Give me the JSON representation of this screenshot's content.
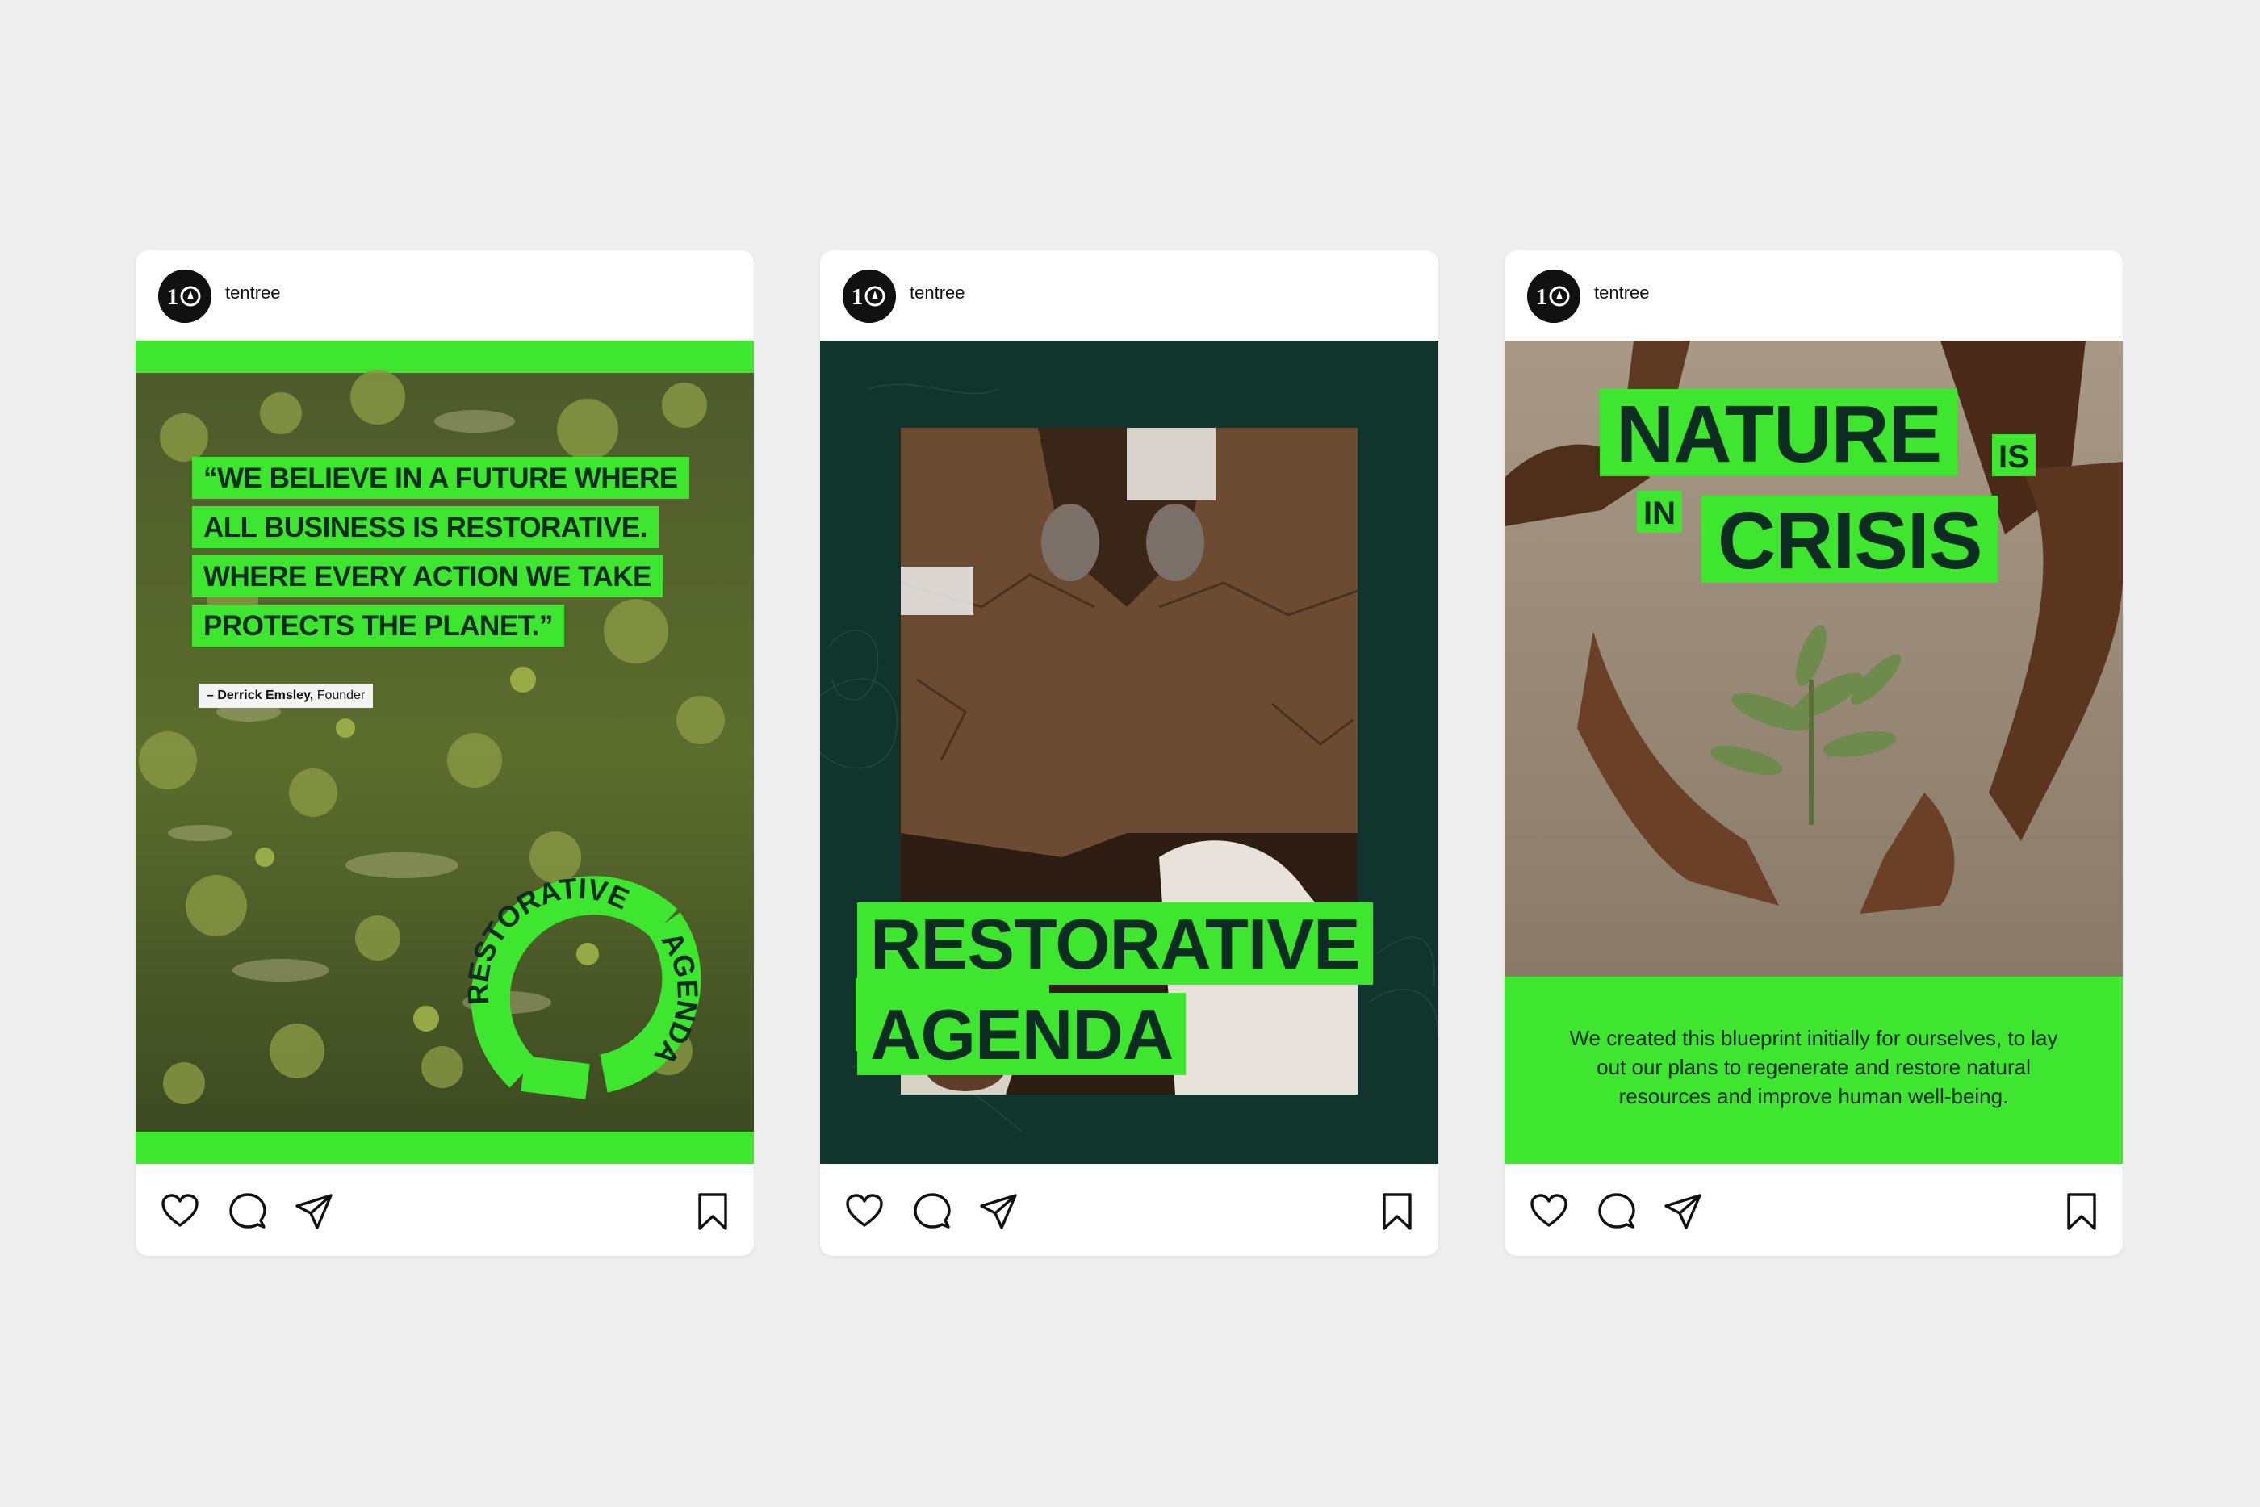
{
  "colors": {
    "background": "#efefef",
    "brand_green": "#3ee62f",
    "dark_green": "#0d2c22",
    "card": "#ffffff"
  },
  "posts": [
    {
      "username": "tentree",
      "avatar_text": "10",
      "quote_lines": [
        "“WE BELIEVE IN A FUTURE WHERE",
        "ALL BUSINESS IS RESTORATIVE.",
        "WHERE EVERY ACTION WE TAKE",
        "PROTECTS THE PLANET.”"
      ],
      "attribution_name": "– Derrick Emsley,",
      "attribution_role": "Founder",
      "badge_top": "RESTORATIVE",
      "badge_bottom": "AGENDA",
      "icons": [
        "heart-icon",
        "comment-icon",
        "share-icon",
        "bookmark-icon"
      ]
    },
    {
      "username": "tentree",
      "avatar_text": "10",
      "title_line1": "RESTORATIVE",
      "title_line2": "AGENDA",
      "icons": [
        "heart-icon",
        "comment-icon",
        "share-icon",
        "bookmark-icon"
      ]
    },
    {
      "username": "tentree",
      "avatar_text": "10",
      "headline_nature": "NATURE",
      "headline_is": "IS",
      "headline_in": "IN",
      "headline_crisis": "CRISIS",
      "body_text": "We created this blueprint initially for ourselves, to lay out our plans to regenerate and restore natural resources and improve human well-being.",
      "icons": [
        "heart-icon",
        "comment-icon",
        "share-icon",
        "bookmark-icon"
      ]
    }
  ]
}
